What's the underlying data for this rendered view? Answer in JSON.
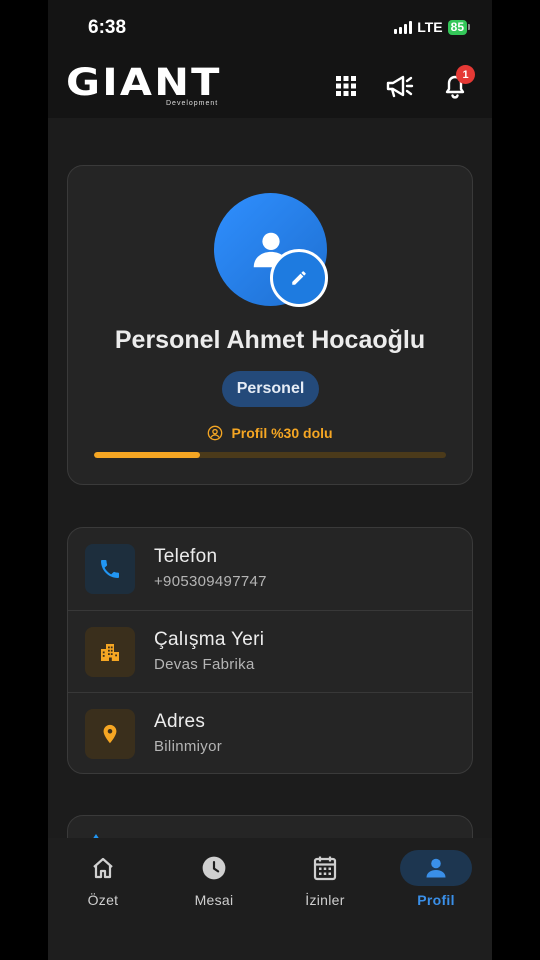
{
  "status_bar": {
    "time": "6:38",
    "network": "LTE",
    "battery": "85"
  },
  "header": {
    "logo_text": "GIANT",
    "logo_subtext": "Development",
    "icons": [
      "apps-grid-icon",
      "megaphone-icon",
      "bell-icon"
    ],
    "notification_count": "1"
  },
  "profile": {
    "name": "Personel Ahmet Hocaoğlu",
    "role": "Personel",
    "progress_label": "Profil %30 dolu",
    "progress_percent": 30
  },
  "info": [
    {
      "title": "Telefon",
      "value": "+905309497747",
      "icon": "phone-icon",
      "icon_color": "#2196f3",
      "icon_bg": "#1d2e3d"
    },
    {
      "title": "Çalışma Yeri",
      "value": "Devas Fabrika",
      "icon": "building-icon",
      "icon_color": "#f5a623",
      "icon_bg": "#3a2f1c"
    },
    {
      "title": "Adres",
      "value": "Bilinmiyor",
      "icon": "location-pin-icon",
      "icon_color": "#f5a623",
      "icon_bg": "#3a2f1c"
    }
  ],
  "nav": [
    {
      "label": "Özet",
      "icon": "home-icon",
      "active": false
    },
    {
      "label": "Mesai",
      "icon": "clock-icon",
      "active": false
    },
    {
      "label": "İzinler",
      "icon": "calendar-icon",
      "active": false
    },
    {
      "label": "Profil",
      "icon": "person-icon",
      "active": true
    }
  ],
  "colors": {
    "accent_blue": "#2196f3",
    "accent_orange": "#f5a623",
    "badge_red": "#e53935",
    "background": "#1c1c1c",
    "card": "#252525"
  }
}
